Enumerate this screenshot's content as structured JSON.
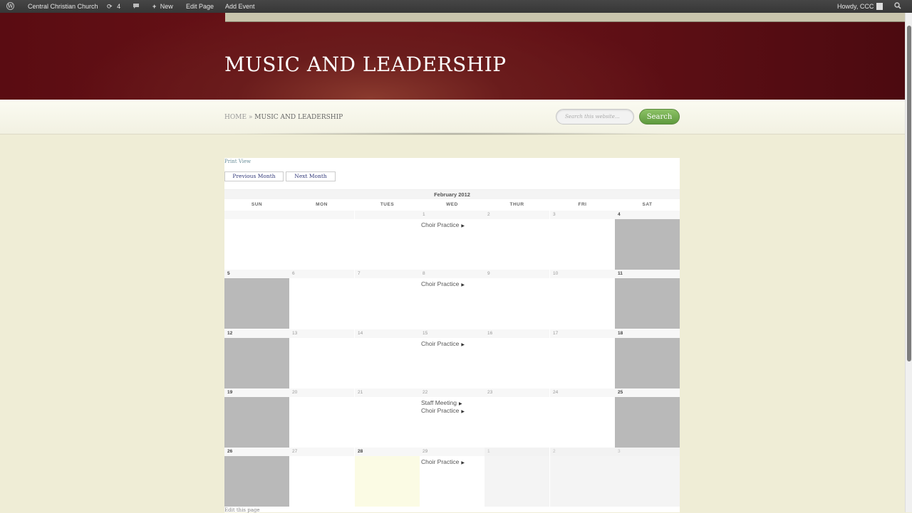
{
  "adminbar": {
    "site_name": "Central Christian Church",
    "updates_count": "4",
    "new_label": "New",
    "edit_page_label": "Edit Page",
    "add_event_label": "Add Event",
    "howdy": "Howdy, CCC"
  },
  "header": {
    "title": "MUSIC AND LEADERSHIP"
  },
  "breadcrumb": {
    "home": "HOME",
    "separator": "»",
    "current": "MUSIC AND LEADERSHIP"
  },
  "search": {
    "placeholder": "Search this website...",
    "button": "Search"
  },
  "calendar": {
    "print_view": "Print View",
    "prev_month": "Previous Month",
    "next_month": "Next Month",
    "month_title": "February 2012",
    "days_of_week": [
      "SUN",
      "MON",
      "TUES",
      "WED",
      "THUR",
      "FRI",
      "SAT"
    ],
    "weeks": [
      [
        {
          "d": "",
          "t": "empty"
        },
        {
          "d": "",
          "t": "empty"
        },
        {
          "d": "",
          "t": "empty"
        },
        {
          "d": "1",
          "t": "day",
          "events": [
            "Choir Practice"
          ]
        },
        {
          "d": "2",
          "t": "day"
        },
        {
          "d": "3",
          "t": "day"
        },
        {
          "d": "4",
          "t": "weekend"
        }
      ],
      [
        {
          "d": "5",
          "t": "weekend"
        },
        {
          "d": "6",
          "t": "day"
        },
        {
          "d": "7",
          "t": "day"
        },
        {
          "d": "8",
          "t": "day",
          "events": [
            "Choir Practice"
          ]
        },
        {
          "d": "9",
          "t": "day"
        },
        {
          "d": "10",
          "t": "day"
        },
        {
          "d": "11",
          "t": "weekend"
        }
      ],
      [
        {
          "d": "12",
          "t": "weekend"
        },
        {
          "d": "13",
          "t": "day"
        },
        {
          "d": "14",
          "t": "day"
        },
        {
          "d": "15",
          "t": "day",
          "events": [
            "Choir Practice"
          ]
        },
        {
          "d": "16",
          "t": "day"
        },
        {
          "d": "17",
          "t": "day"
        },
        {
          "d": "18",
          "t": "weekend"
        }
      ],
      [
        {
          "d": "19",
          "t": "weekend"
        },
        {
          "d": "20",
          "t": "day"
        },
        {
          "d": "21",
          "t": "day"
        },
        {
          "d": "22",
          "t": "day",
          "events": [
            "Staff Meeting",
            "Choir Practice"
          ]
        },
        {
          "d": "23",
          "t": "day"
        },
        {
          "d": "24",
          "t": "day"
        },
        {
          "d": "25",
          "t": "weekend"
        }
      ],
      [
        {
          "d": "26",
          "t": "weekend"
        },
        {
          "d": "27",
          "t": "day"
        },
        {
          "d": "28",
          "t": "today"
        },
        {
          "d": "29",
          "t": "day",
          "events": [
            "Choir Practice"
          ]
        },
        {
          "d": "1",
          "t": "other"
        },
        {
          "d": "2",
          "t": "other"
        },
        {
          "d": "3",
          "t": "other"
        }
      ]
    ]
  },
  "footer": {
    "edit_link": "Edit this page"
  },
  "icons": {
    "wp_logo": "wordpress-logo-icon",
    "updates": "refresh-icon",
    "comments": "comment-bubble-icon",
    "new": "plus-icon",
    "search": "search-icon"
  },
  "colors": {
    "header_bg": "#5a0c12",
    "page_bg": "#efedd6",
    "search_button": "#6ea84a",
    "weekend_cell": "#b9b9b9"
  }
}
